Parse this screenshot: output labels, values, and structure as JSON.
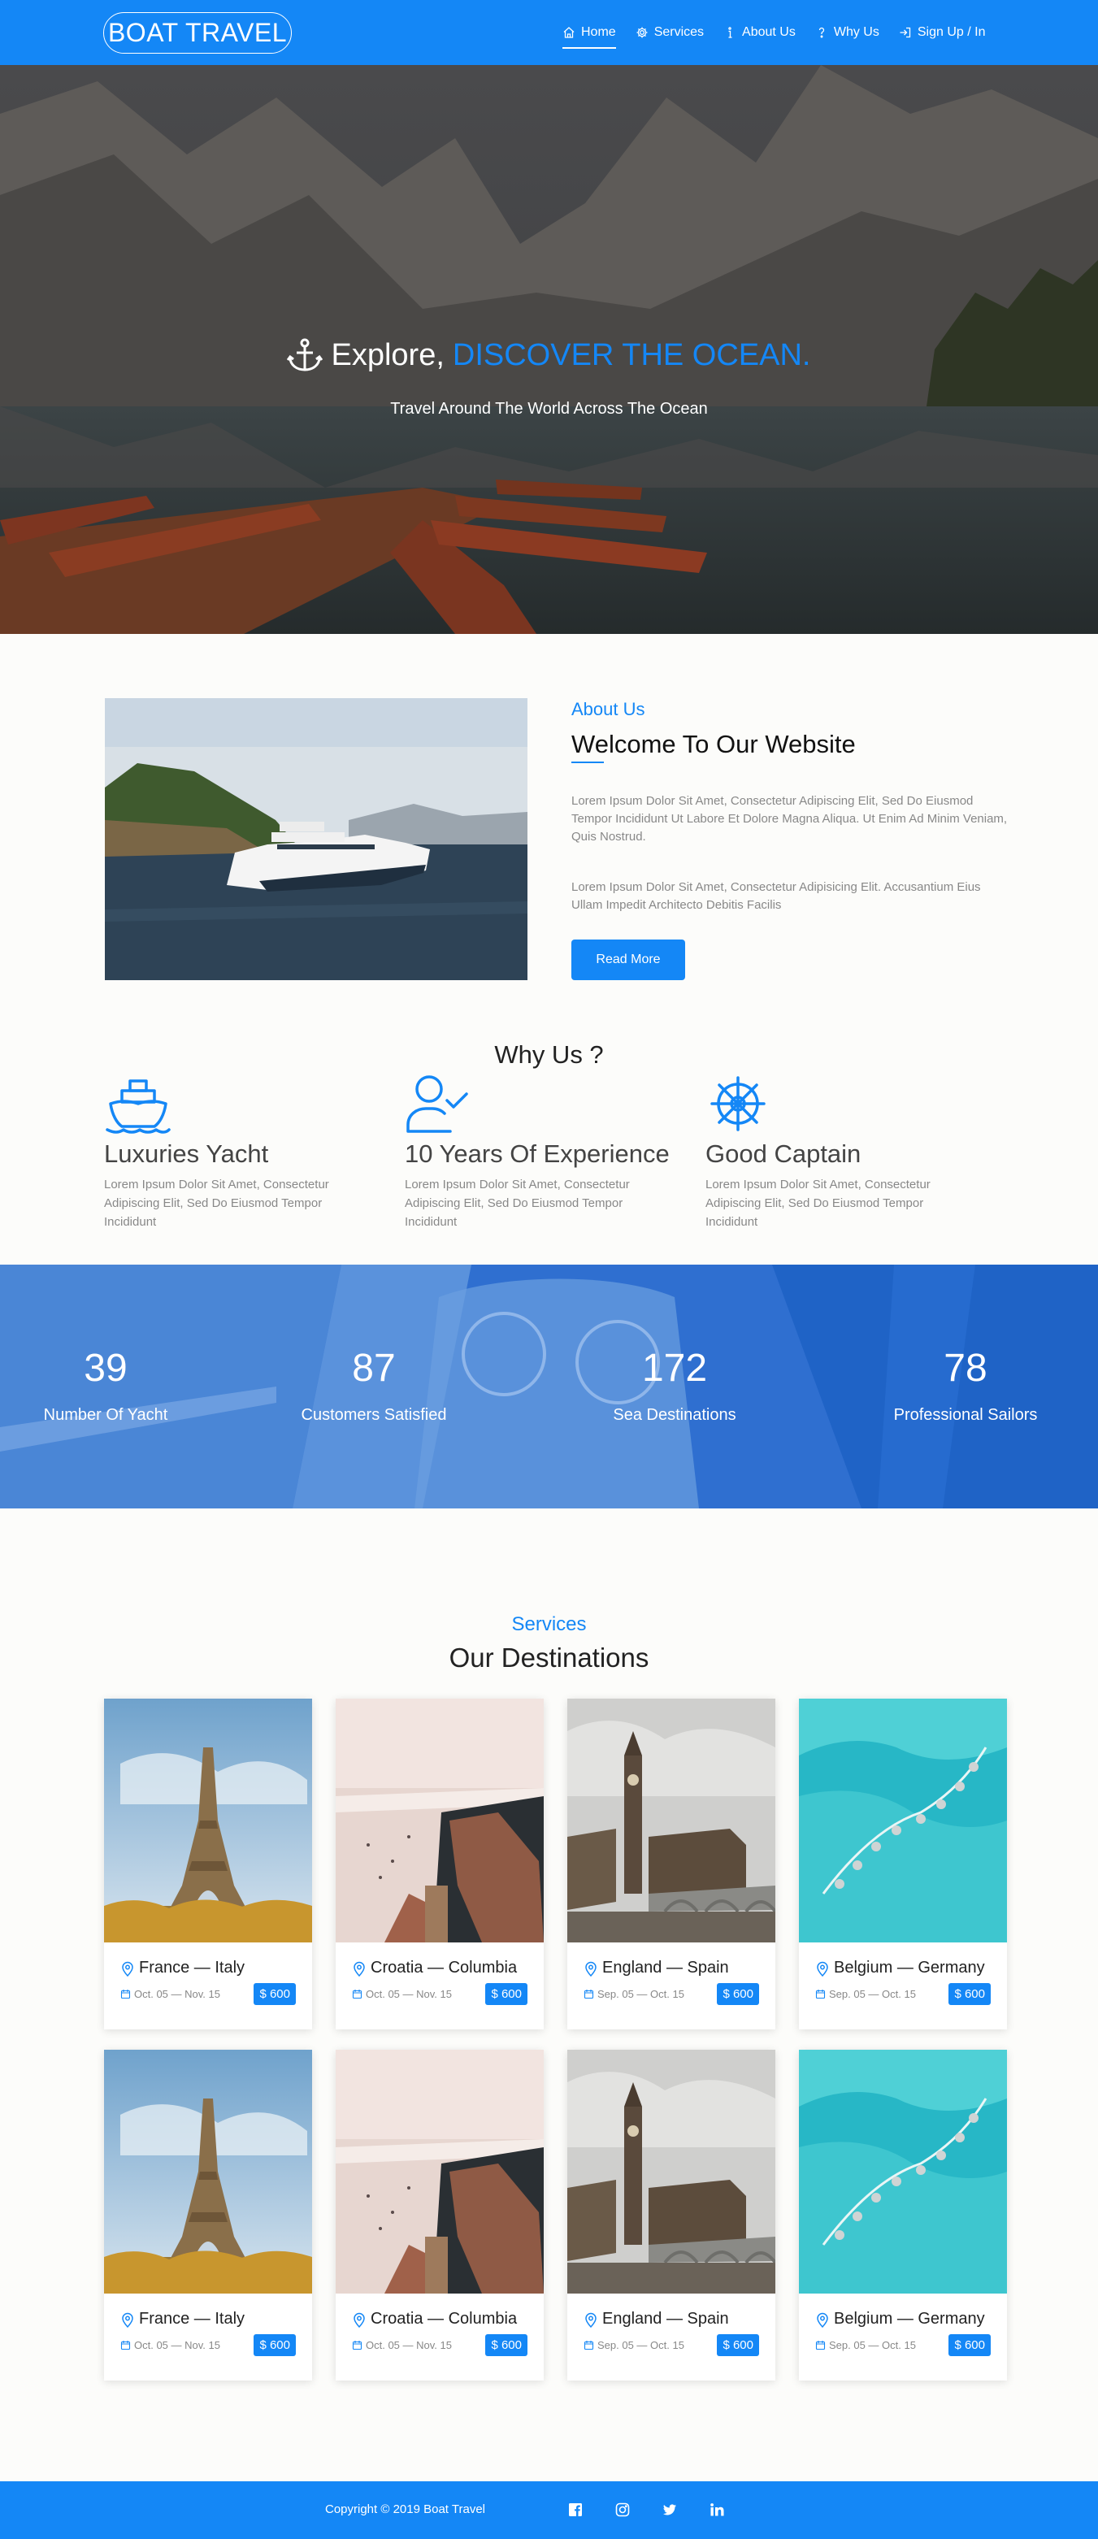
{
  "brand": "BOAT TRAVEL",
  "nav": [
    {
      "label": "Home",
      "icon": "home-icon"
    },
    {
      "label": "Services",
      "icon": "gear-icon"
    },
    {
      "label": "About Us",
      "icon": "info-icon"
    },
    {
      "label": "Why Us",
      "icon": "question-icon"
    },
    {
      "label": "Sign Up / In",
      "icon": "sign-in-icon"
    }
  ],
  "hero": {
    "title_prefix": "Explore,",
    "title_accent": "DISCOVER THE OCEAN.",
    "subtitle": "Travel Around The World Across The Ocean"
  },
  "about": {
    "kicker": "About Us",
    "title": "Welcome To Our Website",
    "p1": "Lorem Ipsum Dolor Sit Amet, Consectetur Adipiscing Elit, Sed Do Eiusmod Tempor Incididunt Ut Labore Et Dolore Magna Aliqua. Ut Enim Ad Minim Veniam, Quis Nostrud.",
    "p2": "Lorem Ipsum Dolor Sit Amet, Consectetur Adipisicing Elit. Accusantium Eius Ullam Impedit Architecto Debitis Facilis",
    "button": "Read More"
  },
  "why": {
    "title": "Why Us ?",
    "items": [
      {
        "title": "Luxuries Yacht",
        "text": "Lorem Ipsum Dolor Sit Amet, Consectetur Adipiscing Elit, Sed Do Eiusmod Tempor Incididunt",
        "icon": "ship-icon"
      },
      {
        "title": "10 Years Of Experience",
        "text": "Lorem Ipsum Dolor Sit Amet, Consectetur Adipiscing Elit, Sed Do Eiusmod Tempor Incididunt",
        "icon": "user-check-icon"
      },
      {
        "title": "Good Captain",
        "text": "Lorem Ipsum Dolor Sit Amet, Consectetur Adipiscing Elit, Sed Do Eiusmod Tempor Incididunt",
        "icon": "ship-wheel-icon"
      }
    ]
  },
  "stats": [
    {
      "num": "39",
      "label": "Number Of Yacht"
    },
    {
      "num": "87",
      "label": "Customers Satisfied"
    },
    {
      "num": "172",
      "label": "Sea Destinations"
    },
    {
      "num": "78",
      "label": "Professional Sailors"
    }
  ],
  "destinations": {
    "kicker": "Services",
    "title": "Our Destinations",
    "cards": [
      {
        "name": "France — Italy",
        "dates": "Oct. 05 — Nov. 15",
        "price": "$ 600",
        "scene": "eiffel"
      },
      {
        "name": "Croatia — Columbia",
        "dates": "Oct. 05 — Nov. 15",
        "price": "$ 600",
        "scene": "coast"
      },
      {
        "name": "England — Spain",
        "dates": "Sep. 05 — Oct. 15",
        "price": "$ 600",
        "scene": "london"
      },
      {
        "name": "Belgium — Germany",
        "dates": "Sep. 05 — Oct. 15",
        "price": "$ 600",
        "scene": "maldives"
      },
      {
        "name": "France — Italy",
        "dates": "Oct. 05 — Nov. 15",
        "price": "$ 600",
        "scene": "eiffel"
      },
      {
        "name": "Croatia — Columbia",
        "dates": "Oct. 05 — Nov. 15",
        "price": "$ 600",
        "scene": "coast"
      },
      {
        "name": "England — Spain",
        "dates": "Sep. 05 — Oct. 15",
        "price": "$ 600",
        "scene": "london"
      },
      {
        "name": "Belgium — Germany",
        "dates": "Sep. 05 — Oct. 15",
        "price": "$ 600",
        "scene": "maldives"
      }
    ]
  },
  "footer": {
    "copyright": "Copyright © 2019 Boat Travel",
    "socials": [
      "facebook-icon",
      "instagram-icon",
      "twitter-icon",
      "linkedin-icon"
    ]
  },
  "colors": {
    "accent": "#1487f6",
    "muted_text": "#888888"
  }
}
